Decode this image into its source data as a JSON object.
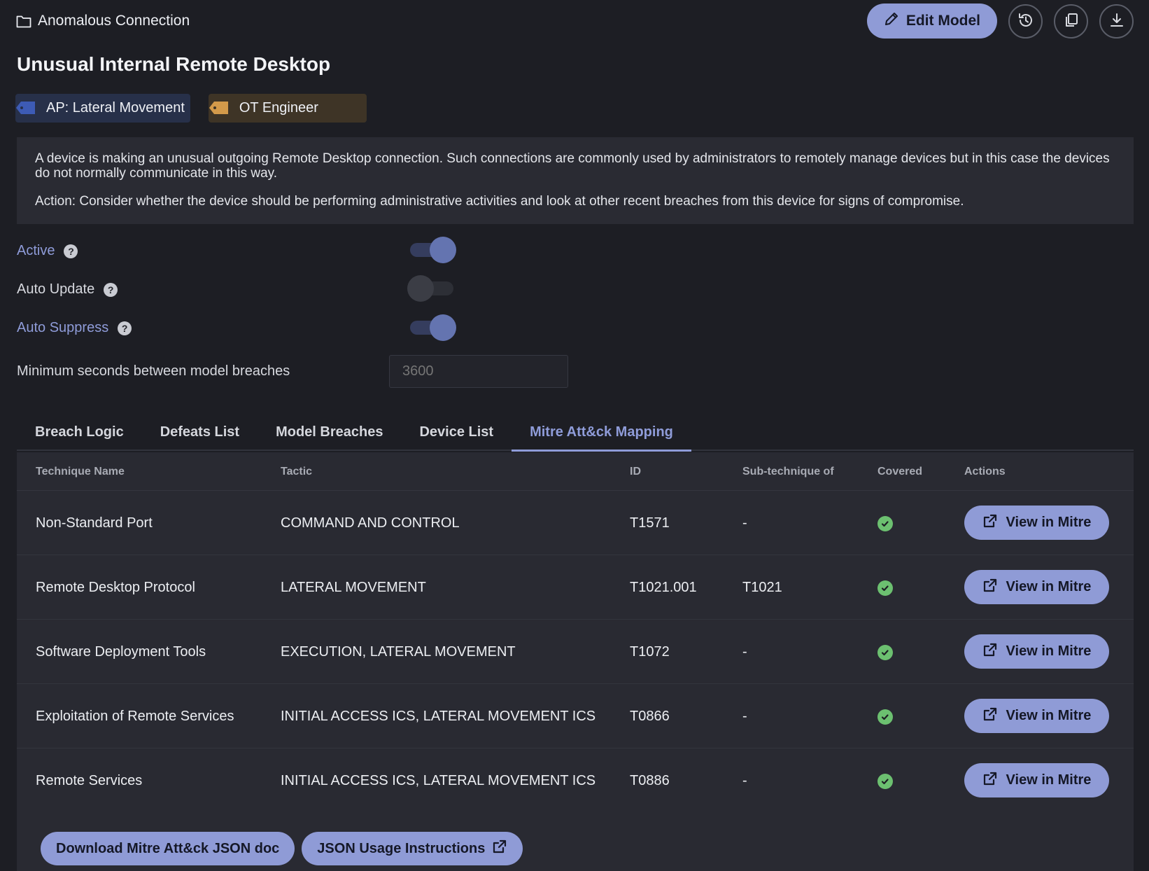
{
  "breadcrumb": {
    "folder_icon": "folder-icon",
    "label": "Anomalous Connection"
  },
  "header": {
    "edit_label": "Edit Model",
    "icons": [
      "pencil-icon",
      "history-icon",
      "copy-icon",
      "download-icon"
    ]
  },
  "page_title": "Unusual Internal Remote Desktop",
  "tags": [
    {
      "label": "AP: Lateral Movement",
      "color": "#3d5bb5"
    },
    {
      "label": "OT Engineer",
      "color": "#d39a4a"
    }
  ],
  "description": {
    "text": "A device is making an unusual outgoing Remote Desktop connection. Such connections are commonly used by administrators to remotely manage devices but in this case the devices do not normally communicate in this way.",
    "action": "Action: Consider whether the device should be performing administrative activities and look at other recent breaches from this device for signs of compromise."
  },
  "settings": {
    "active": {
      "label": "Active",
      "help": "?",
      "on": true
    },
    "auto_update": {
      "label": "Auto Update",
      "help": "?",
      "on": false
    },
    "auto_suppress": {
      "label": "Auto Suppress",
      "help": "?",
      "on": true
    },
    "min_seconds": {
      "label": "Minimum seconds between model breaches",
      "placeholder": "3600"
    }
  },
  "tabs": [
    {
      "label": "Breach Logic",
      "active": false
    },
    {
      "label": "Defeats List",
      "active": false
    },
    {
      "label": "Model Breaches",
      "active": false
    },
    {
      "label": "Device List",
      "active": false
    },
    {
      "label": "Mitre Att&ck Mapping",
      "active": true
    }
  ],
  "table": {
    "headers": [
      "Technique Name",
      "Tactic",
      "ID",
      "Sub-technique of",
      "Covered",
      "Actions"
    ],
    "rows": [
      {
        "name": "Non-Standard Port",
        "tactic": "COMMAND AND CONTROL",
        "id": "T1571",
        "sub": "-",
        "covered": true,
        "action": "View in Mitre"
      },
      {
        "name": "Remote Desktop Protocol",
        "tactic": "LATERAL MOVEMENT",
        "id": "T1021.001",
        "sub": "T1021",
        "covered": true,
        "action": "View in Mitre"
      },
      {
        "name": "Software Deployment Tools",
        "tactic": "EXECUTION, LATERAL MOVEMENT",
        "id": "T1072",
        "sub": "-",
        "covered": true,
        "action": "View in Mitre"
      },
      {
        "name": "Exploitation of Remote Services",
        "tactic": "INITIAL ACCESS ICS, LATERAL MOVEMENT ICS",
        "id": "T0866",
        "sub": "-",
        "covered": true,
        "action": "View in Mitre"
      },
      {
        "name": "Remote Services",
        "tactic": "INITIAL ACCESS ICS, LATERAL MOVEMENT ICS",
        "id": "T0886",
        "sub": "-",
        "covered": true,
        "action": "View in Mitre"
      }
    ]
  },
  "bottom": {
    "download_label": "Download Mitre Att&ck JSON doc",
    "usage_label": "JSON Usage Instructions"
  },
  "colors": {
    "accent": "#8f9bd6",
    "background": "#1d1e24",
    "panel": "#292a32",
    "covered": "#6cc070"
  }
}
